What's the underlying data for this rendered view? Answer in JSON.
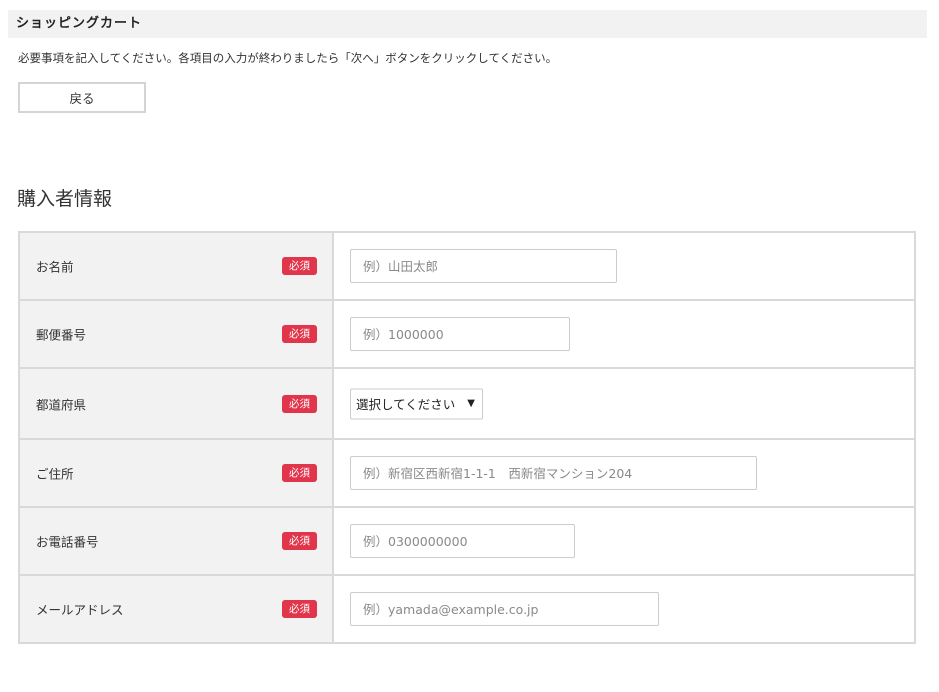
{
  "header": {
    "title": "ショッピングカート"
  },
  "instructions": "必要事項を記入してください。各項目の入力が終わりましたら「次へ」ボタンをクリックしてください。",
  "back_button": {
    "label": "戻る"
  },
  "section": {
    "title": "購入者情報"
  },
  "form": {
    "required_label": "必須",
    "badge_color": "#e0354b",
    "rows": [
      {
        "label": "お名前",
        "type": "text",
        "placeholder": "例）山田太郎",
        "value": ""
      },
      {
        "label": "郵便番号",
        "type": "text",
        "placeholder": "例）1000000",
        "value": ""
      },
      {
        "label": "都道府県",
        "type": "select",
        "selected": "選択してください"
      },
      {
        "label": "ご住所",
        "type": "text",
        "placeholder": "例）新宿区西新宿1-1-1　西新宿マンション204",
        "value": ""
      },
      {
        "label": "お電話番号",
        "type": "text",
        "placeholder": "例）0300000000",
        "value": ""
      },
      {
        "label": "メールアドレス",
        "type": "text",
        "placeholder": "例）yamada@example.co.jp",
        "value": ""
      }
    ]
  }
}
